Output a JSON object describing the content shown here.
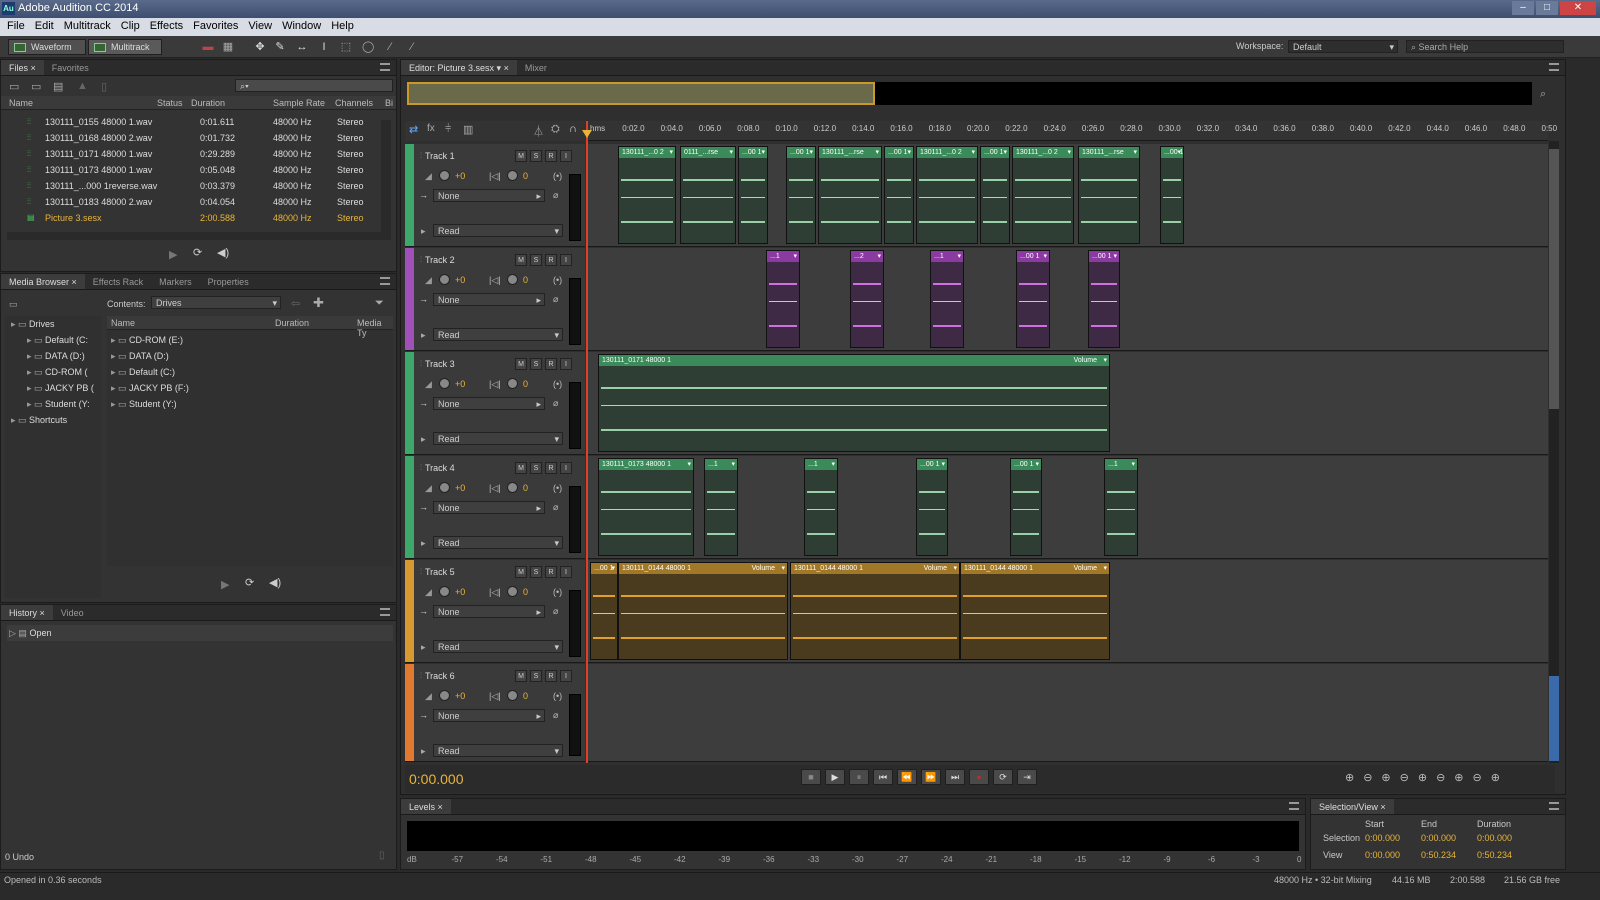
{
  "window": {
    "title": "Adobe Audition CC 2014",
    "app_icon": "Au"
  },
  "menu": [
    "File",
    "Edit",
    "Multitrack",
    "Clip",
    "Effects",
    "Favorites",
    "View",
    "Window",
    "Help"
  ],
  "toolbar": {
    "waveform": "Waveform",
    "multitrack": "Multitrack",
    "workspace_label": "Workspace:",
    "workspace_value": "Default",
    "search_placeholder": "Search Help"
  },
  "files_panel": {
    "tabs": [
      "Files",
      "Favorites"
    ],
    "columns": [
      "Name",
      "Status",
      "Duration",
      "Sample Rate",
      "Channels",
      "Bi"
    ],
    "rows": [
      {
        "name": "130111_0155 48000 1.wav",
        "duration": "0:01.611",
        "rate": "48000 Hz",
        "channels": "Stereo"
      },
      {
        "name": "130111_0168 48000 2.wav",
        "duration": "0:01.732",
        "rate": "48000 Hz",
        "channels": "Stereo"
      },
      {
        "name": "130111_0171 48000 1.wav",
        "duration": "0:29.289",
        "rate": "48000 Hz",
        "channels": "Stereo"
      },
      {
        "name": "130111_0173 48000 1.wav",
        "duration": "0:05.048",
        "rate": "48000 Hz",
        "channels": "Stereo"
      },
      {
        "name": "130111_...000 1reverse.wav",
        "duration": "0:03.379",
        "rate": "48000 Hz",
        "channels": "Stereo"
      },
      {
        "name": "130111_0183 48000 2.wav",
        "duration": "0:04.054",
        "rate": "48000 Hz",
        "channels": "Stereo"
      },
      {
        "name": "Picture 3.sesx",
        "duration": "2:00.588",
        "rate": "48000 Hz",
        "channels": "Stereo"
      }
    ]
  },
  "media_browser": {
    "tabs": [
      "Media Browser",
      "Effects Rack",
      "Markers",
      "Properties"
    ],
    "contents_label": "Contents:",
    "contents_value": "Drives",
    "tree": [
      "Drives",
      "Default (C:",
      "DATA (D:)",
      "CD-ROM (",
      "JACKY PB (",
      "Student (Y:",
      "Shortcuts"
    ],
    "columns": [
      "Name",
      "Duration",
      "Media Ty"
    ],
    "list": [
      "CD-ROM (E:)",
      "DATA (D:)",
      "Default (C:)",
      "JACKY PB (F:)",
      "Student (Y:)"
    ]
  },
  "history": {
    "tabs": [
      "History",
      "Video"
    ],
    "items": [
      "Open"
    ],
    "undo": "0 Undo"
  },
  "editor": {
    "tabs": [
      "Editor: Picture 3.sesx",
      "Mixer"
    ],
    "ruler": [
      "hms",
      "0:02.0",
      "0:04.0",
      "0:06.0",
      "0:08.0",
      "0:10.0",
      "0:12.0",
      "0:14.0",
      "0:16.0",
      "0:18.0",
      "0:20.0",
      "0:22.0",
      "0:24.0",
      "0:26.0",
      "0:28.0",
      "0:30.0",
      "0:32.0",
      "0:34.0",
      "0:36.0",
      "0:38.0",
      "0:40.0",
      "0:42.0",
      "0:44.0",
      "0:46.0",
      "0:48.0",
      "0:50"
    ],
    "timecode": "0:00.000"
  },
  "tracks": [
    {
      "name": "Track 1",
      "color": "#3ea86a",
      "vol": "+0",
      "pan": "0",
      "input": "None",
      "mode": "Read"
    },
    {
      "name": "Track 2",
      "color": "#a050b8",
      "vol": "+0",
      "pan": "0",
      "input": "None",
      "mode": "Read"
    },
    {
      "name": "Track 3",
      "color": "#3ea86a",
      "vol": "+0",
      "pan": "0",
      "input": "None",
      "mode": "Read"
    },
    {
      "name": "Track 4",
      "color": "#3ea86a",
      "vol": "+0",
      "pan": "0",
      "input": "None",
      "mode": "Read"
    },
    {
      "name": "Track 5",
      "color": "#d89a30",
      "vol": "+0",
      "pan": "0",
      "input": "None",
      "mode": "Read"
    },
    {
      "name": "Track 6",
      "color": "#e07a30",
      "vol": "+0",
      "pan": "0",
      "input": "None",
      "mode": "Read"
    }
  ],
  "track_buttons": [
    "M",
    "S",
    "R",
    "I"
  ],
  "clips": {
    "t1": [
      "130111_...0 2",
      "0111_...rse",
      "...00 1",
      "...00 1",
      "130111_...rse",
      "...00 1",
      "130111_...0 2",
      "...00 1",
      "130111_...0 2",
      "130111_...rse",
      "...00 1"
    ],
    "t2": [
      "...1",
      "...2",
      "...1",
      "...00 1",
      "...00 1"
    ],
    "t3": [
      "130111_0171 48000 1",
      "Volume"
    ],
    "t4": [
      "130111_0173 48000 1",
      "...1",
      "...1",
      "...00 1",
      "...00 1",
      "...1"
    ],
    "t5": [
      "...00 1",
      "130111_0144 48000 1",
      "Volume",
      "130111_0144 48000 1",
      "Volume",
      "130111_0144 48000 1",
      "Volume"
    ]
  },
  "levels": {
    "tab": "Levels",
    "scale": [
      "dB",
      "-57",
      "-54",
      "-51",
      "-48",
      "-45",
      "-42",
      "-39",
      "-36",
      "-33",
      "-30",
      "-27",
      "-24",
      "-21",
      "-18",
      "-15",
      "-12",
      "-9",
      "-6",
      "-3",
      "0"
    ]
  },
  "selection_view": {
    "tab": "Selection/View",
    "cols": [
      "Start",
      "End",
      "Duration"
    ],
    "selection": [
      "0:00.000",
      "0:00.000",
      "0:00.000"
    ],
    "view": [
      "0:00.000",
      "0:50.234",
      "0:50.234"
    ],
    "row_labels": [
      "Selection",
      "View"
    ]
  },
  "status": {
    "left": "Opened in 0.36 seconds",
    "rate": "48000 Hz • 32-bit Mixing",
    "mem": "44.16 MB",
    "dur": "2:00.588",
    "free": "21.56 GB free"
  }
}
